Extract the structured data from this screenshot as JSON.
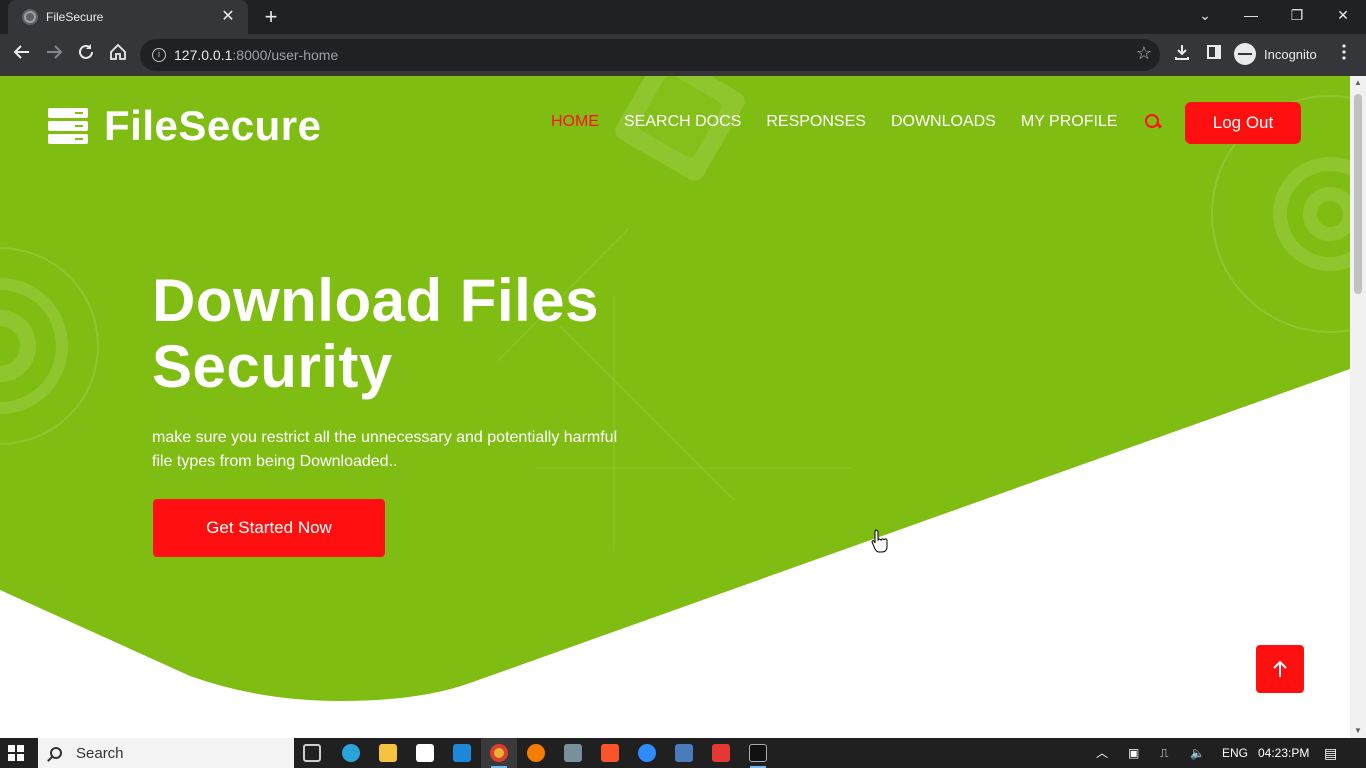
{
  "browser": {
    "tab_title": "FileSecure",
    "tab_close": "✕",
    "new_tab": "+",
    "url_host": "127.0.0.1",
    "url_rest": ":8000/user-home",
    "profile_label": "Incognito",
    "window_controls": [
      "⌄",
      "—",
      "❐",
      "✕"
    ]
  },
  "site": {
    "brand": "FileSecure",
    "nav": [
      {
        "label": "HOME",
        "active": true
      },
      {
        "label": "SEARCH DOCS",
        "active": false
      },
      {
        "label": "RESPONSES",
        "active": false
      },
      {
        "label": "DOWNLOADS",
        "active": false
      },
      {
        "label": "MY PROFILE",
        "active": false
      }
    ],
    "logout_label": "Log Out",
    "hero": {
      "title_line1": "Download Files",
      "title_line2": "Security",
      "subtitle_line1": "make sure you restrict all the unnecessary and potentially harmful",
      "subtitle_line2": "file types from being Downloaded..",
      "cta_label": "Get Started Now"
    },
    "colors": {
      "hero_green": "#80bd12",
      "accent_red": "#ff0f0f",
      "active_nav": "#ff1111"
    }
  },
  "taskbar": {
    "search_label": "Search",
    "language": "ENG",
    "time": "04:23:PM"
  }
}
